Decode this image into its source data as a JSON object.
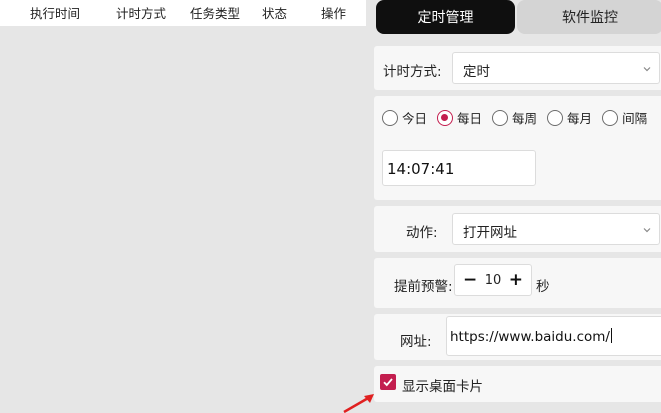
{
  "table": {
    "columns": [
      "执行时间",
      "计时方式",
      "任务类型",
      "状态",
      "操作"
    ]
  },
  "tabs": {
    "schedule": "定时管理",
    "monitor": "软件监控"
  },
  "timing": {
    "label": "计时方式:",
    "value": "定时"
  },
  "frequency": {
    "options": [
      "今日",
      "每日",
      "每周",
      "每月",
      "间隔"
    ],
    "selected": "每日"
  },
  "time": {
    "value": "14:07:41"
  },
  "action": {
    "label": "动作:",
    "value": "打开网址"
  },
  "warning": {
    "label": "提前预警:",
    "value": "10",
    "unit": "秒"
  },
  "url": {
    "label": "网址:",
    "value": "https://www.baidu.com/"
  },
  "desktop_card": {
    "label": "显示桌面卡片",
    "checked": true
  },
  "colors": {
    "accent": "#c31e4f",
    "tab_active_bg": "#0f0f0f"
  }
}
